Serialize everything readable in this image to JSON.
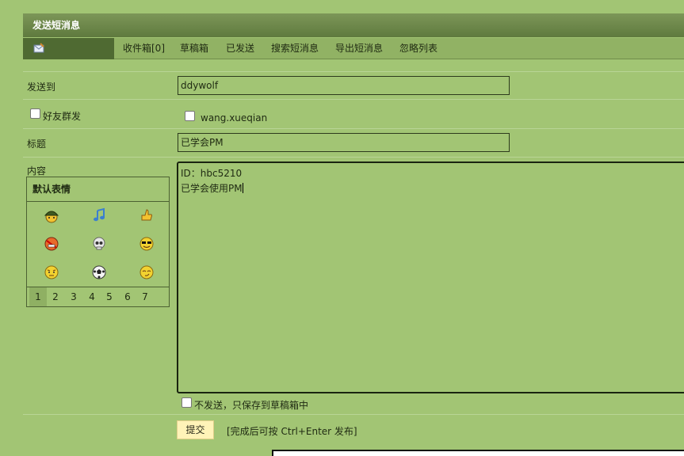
{
  "header": {
    "title": "发送短消息"
  },
  "tabs": [
    {
      "label": "收件箱[0]"
    },
    {
      "label": "草稿箱"
    },
    {
      "label": "已发送"
    },
    {
      "label": "搜索短消息"
    },
    {
      "label": "导出短消息"
    },
    {
      "label": "忽略列表"
    }
  ],
  "form": {
    "to_label": "发送到",
    "to_value": "ddywolf",
    "friends_label": "好友群发",
    "friend_name": "wang.xueqian",
    "subject_label": "标题",
    "subject_value": "已学会PM",
    "content_label": "内容",
    "content_line1": "ID：hbc5210",
    "content_line2": "已学会使用PM",
    "save_only_label": "不发送，只保存到草稿箱中",
    "submit_label": "提交",
    "hint": "[完成后可按 Ctrl+Enter 发布]"
  },
  "emoji_panel": {
    "title": "默认表情",
    "icons": [
      "army-helmet-icon",
      "music-note-icon",
      "thumbs-up-icon",
      "angry-no-talking-icon",
      "skull-icon",
      "cool-sunglasses-icon",
      "annoyed-face-icon",
      "soccer-ball-icon",
      "smug-face-icon"
    ],
    "pages": [
      "1",
      "2",
      "3",
      "4",
      "5",
      "6",
      "7"
    ],
    "active_page": "1"
  }
}
